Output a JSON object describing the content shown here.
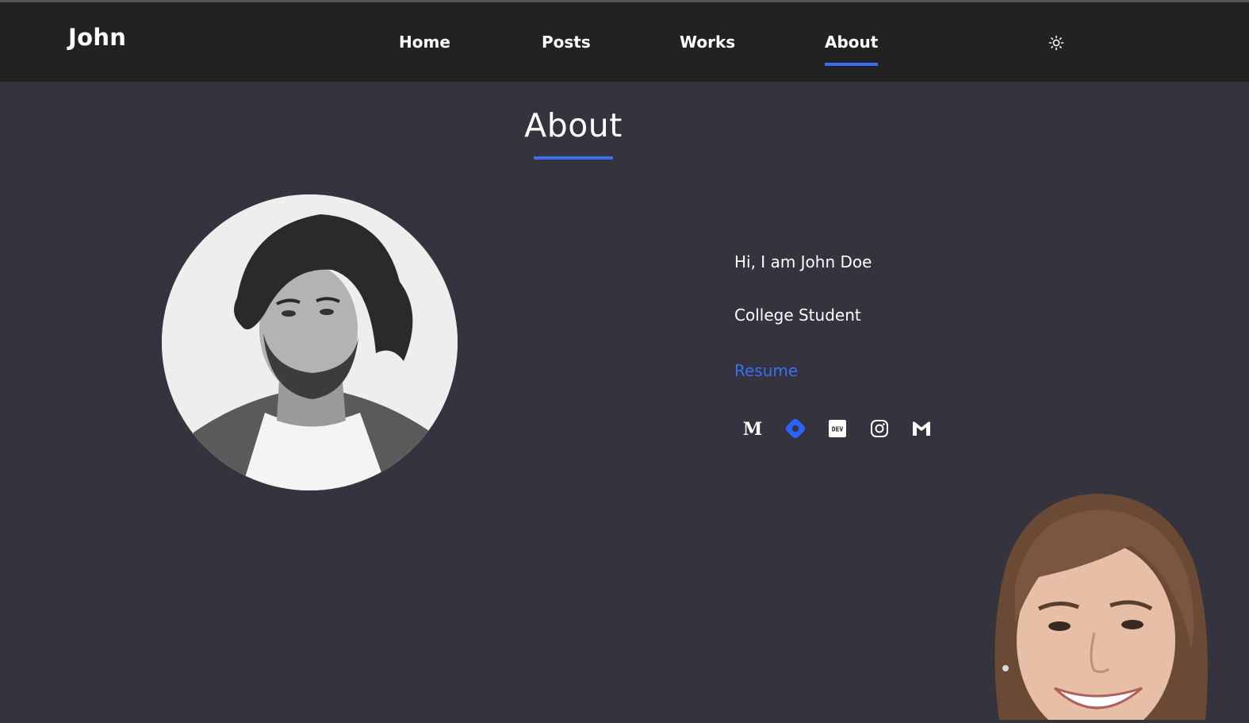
{
  "brand": {
    "name": "John"
  },
  "nav": {
    "items": [
      {
        "label": "Home",
        "active": false
      },
      {
        "label": "Posts",
        "active": false
      },
      {
        "label": "Works",
        "active": false
      },
      {
        "label": "About",
        "active": true
      }
    ],
    "theme_toggle_icon": "sun-icon"
  },
  "page": {
    "title": "About"
  },
  "profile": {
    "avatar_icon": "profile-photo",
    "greeting": "Hi, I am John Doe",
    "role": "College Student",
    "resume_label": "Resume"
  },
  "socials": [
    {
      "icon": "medium-icon"
    },
    {
      "icon": "hashnode-icon"
    },
    {
      "icon": "dev-to-icon"
    },
    {
      "icon": "instagram-icon"
    },
    {
      "icon": "gmail-icon"
    }
  ],
  "colors": {
    "background": "#35333d",
    "navbar": "#222222",
    "accent": "#3a6ff2",
    "text": "#ffffff"
  }
}
